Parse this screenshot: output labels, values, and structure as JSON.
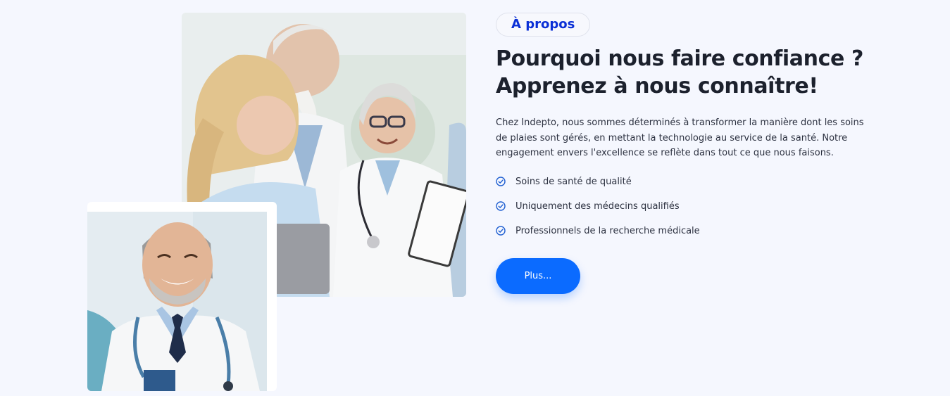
{
  "about": {
    "badge": "À propos",
    "title_line1": "Pourquoi nous faire confiance ?",
    "title_line2": "Apprenez à nous connaître!",
    "description": "Chez Indepto, nous sommes déterminés à transformer la manière dont les soins de plaies sont gérés, en mettant la technologie au service de la santé. Notre engagement envers l'excellence se reflète dans tout ce que nous faisons.",
    "features": [
      {
        "label": "Soins de santé de qualité",
        "icon": "check-circle-icon"
      },
      {
        "label": "Uniquement des médecins qualifiés",
        "icon": "check-circle-icon"
      },
      {
        "label": "Professionnels de la recherche médicale",
        "icon": "check-circle-icon"
      }
    ],
    "button_label": "Plus..."
  },
  "colors": {
    "background": "#f5f7fe",
    "accent": "#0b6bff",
    "badge_text": "#0a2fd6",
    "heading": "#1c212d"
  }
}
